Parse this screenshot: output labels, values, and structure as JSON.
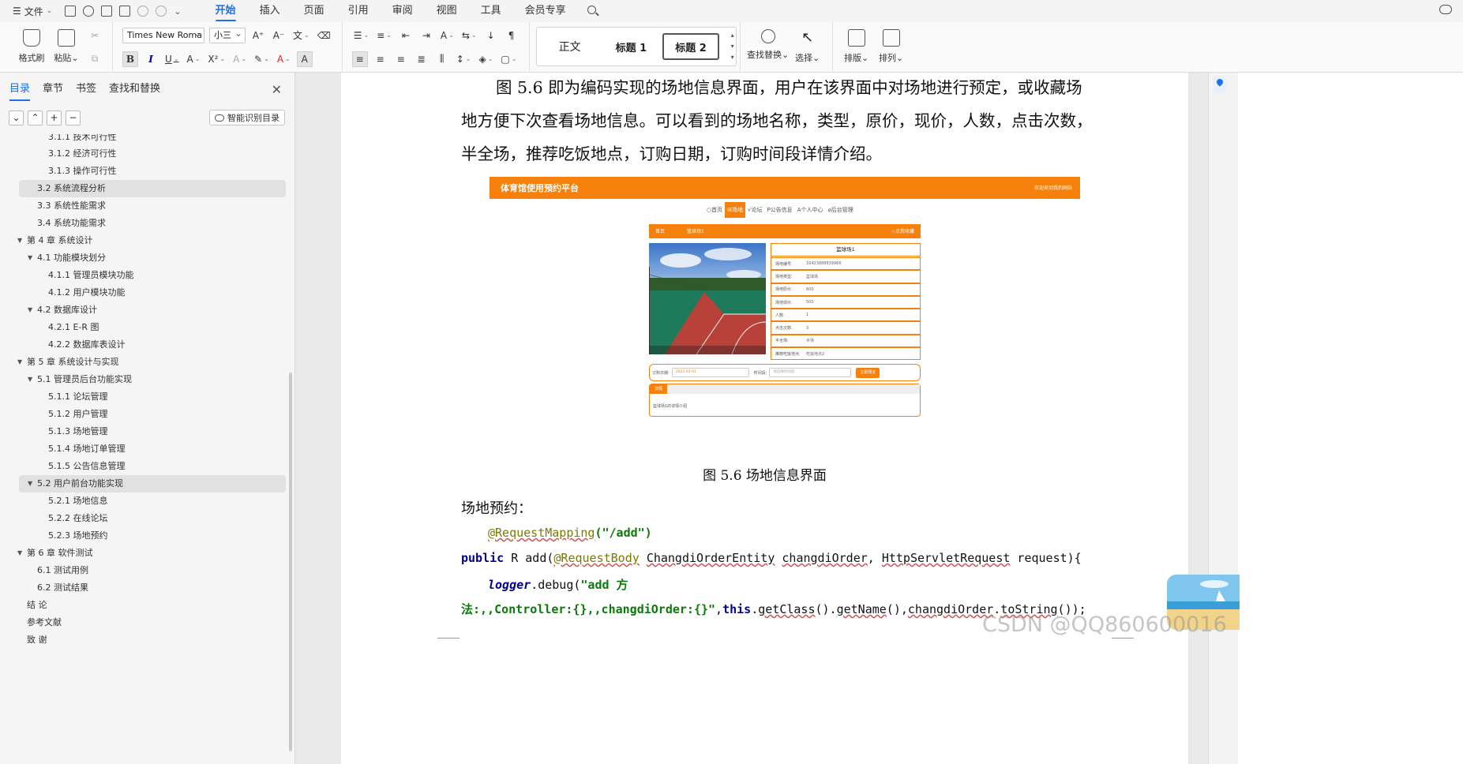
{
  "menubar": {
    "file_label": "文件",
    "tabs": [
      "开始",
      "插入",
      "页面",
      "引用",
      "审阅",
      "视图",
      "工具",
      "会员专享"
    ],
    "active_tab": "开始"
  },
  "ribbon": {
    "format_painter": "格式刷",
    "paste": "粘贴",
    "font_name": "Times New Roma",
    "font_size": "小三",
    "styles": [
      "正文",
      "标题 1",
      "标题 2"
    ],
    "find_replace": "查找替换",
    "select": "选择",
    "layout": "排版",
    "arrange": "排列"
  },
  "navpane": {
    "tabs": [
      "目录",
      "章节",
      "书签",
      "查找和替换"
    ],
    "active_tab": "目录",
    "smart_toc": "智能识别目录",
    "toc": [
      {
        "label": "3.1.1  技术可行性",
        "level": 3,
        "cut": true
      },
      {
        "label": "3.1.2  经济可行性",
        "level": 3
      },
      {
        "label": "3.1.3  操作可行性",
        "level": 3
      },
      {
        "label": "3.2  系统流程分析",
        "level": 2,
        "highlight": true
      },
      {
        "label": "3.3  系统性能需求",
        "level": 2
      },
      {
        "label": "3.4  系统功能需求",
        "level": 2
      },
      {
        "label": "第 4 章  系统设计",
        "level": 1,
        "expanded": true
      },
      {
        "label": "4.1  功能模块划分",
        "level": 2,
        "expanded": true
      },
      {
        "label": "4.1.1  管理员模块功能",
        "level": 3
      },
      {
        "label": "4.1.2  用户模块功能",
        "level": 3
      },
      {
        "label": "4.2  数据库设计",
        "level": 2,
        "expanded": true
      },
      {
        "label": "4.2.1  E-R 图",
        "level": 3
      },
      {
        "label": "4.2.2  数据库表设计",
        "level": 3
      },
      {
        "label": "第 5 章  系统设计与实现",
        "level": 1,
        "expanded": true
      },
      {
        "label": "5.1  管理员后台功能实现",
        "level": 2,
        "expanded": true
      },
      {
        "label": "5.1.1  论坛管理",
        "level": 3
      },
      {
        "label": "5.1.2  用户管理",
        "level": 3
      },
      {
        "label": "5.1.3  场地管理",
        "level": 3
      },
      {
        "label": "5.1.4  场地订单管理",
        "level": 3
      },
      {
        "label": "5.1.5  公告信息管理",
        "level": 3
      },
      {
        "label": "5.2  用户前台功能实现",
        "level": 2,
        "expanded": true,
        "highlight": true
      },
      {
        "label": "5.2.1  场地信息",
        "level": 3
      },
      {
        "label": "5.2.2  在线论坛",
        "level": 3
      },
      {
        "label": "5.2.3  场地预约",
        "level": 3
      },
      {
        "label": "第 6 章  软件测试",
        "level": 1,
        "expanded": true
      },
      {
        "label": "6.1  测试用例",
        "level": 2
      },
      {
        "label": "6.2  测试结果",
        "level": 2
      },
      {
        "label": "结  论",
        "level": 1
      },
      {
        "label": "参考文献",
        "level": 1
      },
      {
        "label": "致  谢",
        "level": 1
      }
    ]
  },
  "doc": {
    "para_lines": [
      "图 5.6  即为编码实现的场地信息界面，用户在该界面中对场地进行预定，或收藏场",
      "地方便下次查看场地信息。可以看到的场地名称，类型，原价，现价，人数，点击次数，",
      "半全场，推荐吃饭地点，订购日期，订购时间段详情介绍。"
    ],
    "caption": "图 5.6  场地信息界面",
    "section_head": "场地预约：",
    "code": {
      "ann": "@RequestMapping",
      "ann_arg": "(\"/add\")",
      "public": "public",
      "sig1": " R add(",
      "rb": "@RequestBody",
      "sig2": " ",
      "entity": "ChangdiOrderEntity",
      "sig3": " ",
      "param": "changdiOrder",
      "sig4": ", ",
      "req": "HttpServletRequest",
      "sig5": " request){",
      "logger": "logger",
      "debug": ".debug(",
      "str1": "\"add 方",
      "str2": "法:,,Controller:{},,changdiOrder:{}\"",
      "comma": ",",
      "this": "this",
      "rest1": ".",
      "getClass": "getClass",
      "rest2": "().",
      "getName": "getName",
      "rest3": "(),",
      "param2": "changdiOrder",
      "rest4": ".",
      "toString": "toString",
      "rest5": "());"
    }
  },
  "figure": {
    "brand": "体育馆使用预约平台",
    "welcome": "欢迎来到我的网站",
    "nav": [
      "○首页",
      "⊞场地",
      "√论坛",
      "P公告信息",
      "A个人中心",
      "⌀后台管理"
    ],
    "nav_active": 1,
    "crumb_home": "首页",
    "crumb_name": "篮球场1",
    "favorite": "☆点我收藏",
    "title": "篮球场1",
    "rows": [
      {
        "k": "场地编号:",
        "v": "16423888839966"
      },
      {
        "k": "场地类型:",
        "v": "篮球场"
      },
      {
        "k": "场地原价:",
        "v": "600"
      },
      {
        "k": "场地现价:",
        "v": "500"
      },
      {
        "k": "人数:",
        "v": "1"
      },
      {
        "k": "点击次数:",
        "v": "3"
      },
      {
        "k": "半全场:",
        "v": "半场"
      },
      {
        "k": "推荐吃饭地点:",
        "v": "吃饭地点2"
      }
    ],
    "order_date_label": "订购日期:",
    "order_date": "2022-03-01",
    "time_label": "时间段:",
    "time_placeholder": "请选择时间段",
    "book_btn": "立即预定",
    "detail_tab": "详情",
    "detail_text": "篮球场1的详情介绍"
  },
  "overlay": {
    "watermark": "CSDN @QQ860600016"
  }
}
